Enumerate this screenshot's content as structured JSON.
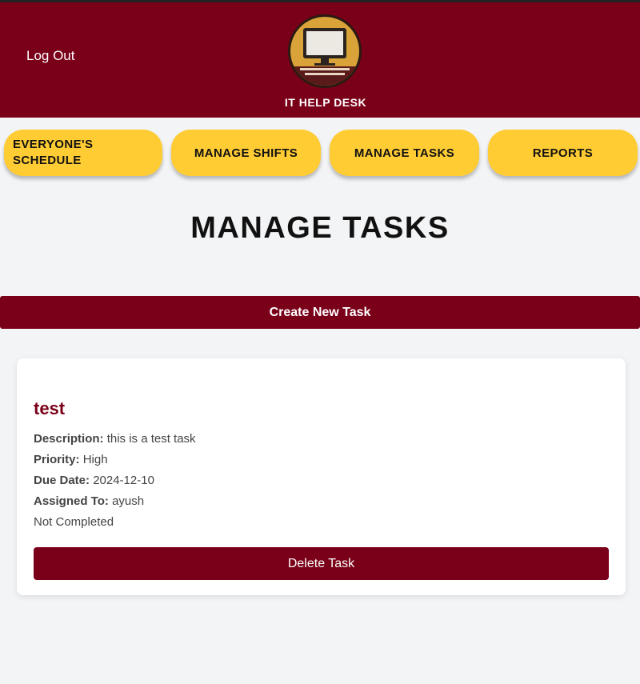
{
  "header": {
    "logout_label": "Log Out",
    "logo_text": "IT HELP DESK"
  },
  "nav": {
    "items": [
      {
        "label": "EVERYONE'S SCHEDULE"
      },
      {
        "label": "MANAGE SHIFTS"
      },
      {
        "label": "MANAGE TASKS"
      },
      {
        "label": "REPORTS"
      }
    ]
  },
  "main": {
    "title": "MANAGE TASKS",
    "create_label": "Create New Task"
  },
  "task": {
    "title": "test",
    "description_label": "Description:",
    "description": "this is a test task",
    "priority_label": "Priority:",
    "priority": "High",
    "due_label": "Due Date:",
    "due": "2024-12-10",
    "assigned_label": "Assigned To:",
    "assigned": "ayush",
    "status": "Not Completed",
    "delete_label": "Delete Task"
  },
  "colors": {
    "brand": "#7a0019",
    "accent": "#ffcc33",
    "background": "#f3f4f6"
  }
}
